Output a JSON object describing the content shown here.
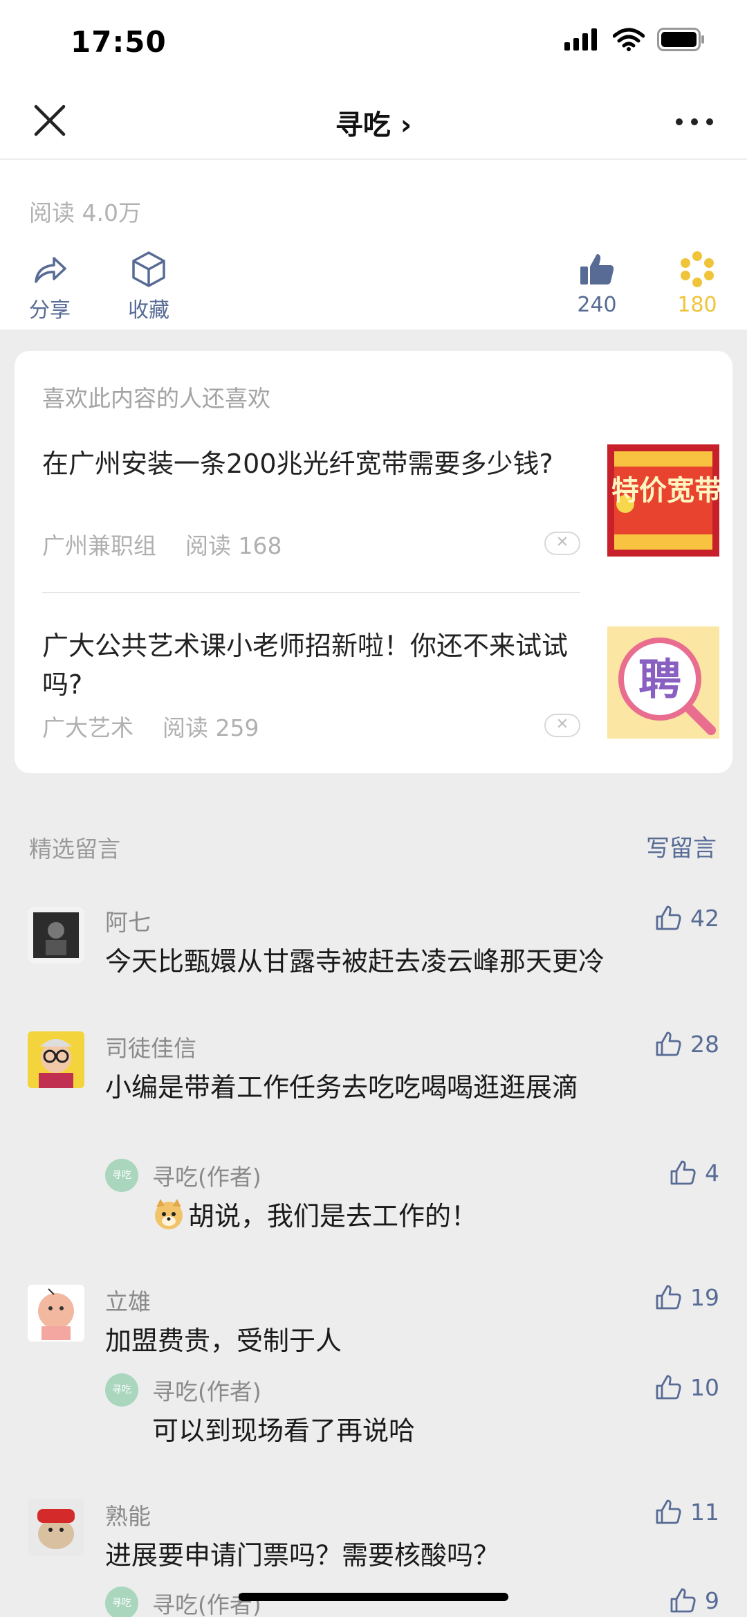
{
  "status_bar": {
    "time": "17:50"
  },
  "nav": {
    "title": "寻吃 ›"
  },
  "article": {
    "read_count": "阅读 4.0万",
    "actions": {
      "share": "分享",
      "favorite": "收藏",
      "like": "240",
      "wow": "180"
    }
  },
  "recommend": {
    "header": "喜欢此内容的人还喜欢",
    "items": [
      {
        "title": "在广州安装一条200兆光纤宽带需要多少钱?",
        "source": "广州兼职组",
        "reads": "阅读 168",
        "thumb_text": "特价宽带"
      },
      {
        "title": "广大公共艺术课小老师招新啦！你还不来试试吗?",
        "source": "广大艺术",
        "reads": "阅读 259",
        "thumb_text": "聘"
      }
    ]
  },
  "comments_header": {
    "title": "精选留言",
    "write": "写留言"
  },
  "comments": [
    {
      "name": "阿七",
      "text": "今天比甄嬛从甘露寺被赶去凌云峰那天更冷",
      "likes": "42"
    },
    {
      "name": "司徒佳信",
      "text": "小编是带着工作任务去吃吃喝喝逛逛展滴",
      "likes": "28",
      "reply": {
        "name": "寻吃(作者)",
        "text": "胡说，我们是去工作的！",
        "likes": "4"
      }
    },
    {
      "name": "立雄",
      "text": "加盟费贵，受制于人",
      "likes": "19",
      "reply": {
        "name": "寻吃(作者)",
        "text": "可以到现场看了再说哈",
        "likes": "10"
      }
    },
    {
      "name": "熟能",
      "text": "进展要申请门票吗？需要核酸吗？",
      "likes": "11",
      "reply": {
        "name": "寻吃(作者)",
        "text": "",
        "likes": "9"
      }
    }
  ],
  "author_avatar_text": "寻吃",
  "colors": {
    "link_blue": "#576b95",
    "wow_gold": "#f0c43a",
    "muted": "#b2b2b2",
    "background": "#ededed"
  }
}
